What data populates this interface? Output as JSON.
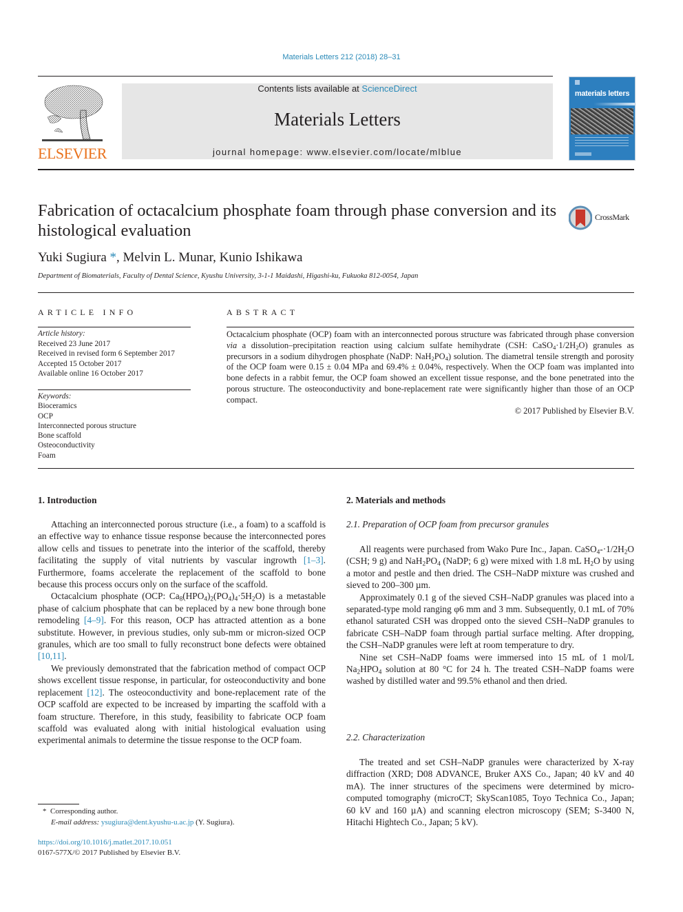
{
  "header": {
    "citation": "Materials Letters 212 (2018) 28–31",
    "contents_prefix": "Contents lists available at ",
    "contents_link": "ScienceDirect",
    "journal_name": "Materials Letters",
    "homepage_prefix": "journal homepage: ",
    "homepage_url": "www.elsevier.com/locate/mlblue",
    "publisher_logo_text": "ELSEVIER",
    "cover_title": "materials letters",
    "colors": {
      "link": "#2a8ab8",
      "publisher_orange": "#e9711c",
      "masthead_bg": "#e6e6e6",
      "cover_blue": "#2d7fbf"
    }
  },
  "article": {
    "title": "Fabrication of octacalcium phosphate foam through phase conversion and its histological evaluation",
    "crossmark_label": "CrossMark",
    "authors": [
      {
        "name": "Yuki Sugiura",
        "mark": "*"
      },
      {
        "name": "Melvin L. Munar",
        "mark": ""
      },
      {
        "name": "Kunio Ishikawa",
        "mark": ""
      }
    ],
    "affiliation": "Department of Biomaterials, Faculty of Dental Science, Kyushu University, 3-1-1 Maidashi, Higashi-ku, Fukuoka 812-0054, Japan"
  },
  "article_info": {
    "heading": "ARTICLE INFO",
    "history_label": "Article history:",
    "history": [
      "Received 23 June 2017",
      "Received in revised form 6 September 2017",
      "Accepted 15 October 2017",
      "Available online 16 October 2017"
    ],
    "keywords_label": "Keywords:",
    "keywords": [
      "Bioceramics",
      "OCP",
      "Interconnected porous structure",
      "Bone scaffold",
      "Osteoconductivity",
      "Foam"
    ]
  },
  "abstract": {
    "heading": "ABSTRACT",
    "p1": "Octacalcium phosphate (OCP) foam with an interconnected porous structure was fabricated through phase conversion ",
    "p1_via": "via",
    "p2": " a dissolution–precipitation reaction using calcium sulfate hemihydrate (CSH: CaSO",
    "p3": "·1/2H",
    "p4": "O) granules as precursors in a sodium dihydrogen phosphate (NaDP: NaH",
    "p5": "PO",
    "p6": ") solution. The diametral tensile strength and porosity of the OCP foam were 0.15 ± 0.04 MPa and 69.4% ± 0.04%, respectively. When the OCP foam was implanted into bone defects in a rabbit femur, the OCP foam showed an excellent tissue response, and the bone penetrated into the porous structure. The osteoconductivity and bone-replacement rate were significantly higher than those of an OCP compact.",
    "copyright": "© 2017 Published by Elsevier B.V."
  },
  "sections": {
    "intro": {
      "heading": "1. Introduction",
      "p1a": "Attaching an interconnected porous structure (i.e., a foam) to a scaffold is an effective way to enhance tissue response because the interconnected pores allow cells and tissues to penetrate into the interior of the scaffold, thereby facilitating the supply of vital nutrients by vascular ingrowth ",
      "p1_ref": "[1–3]",
      "p1b": ". Furthermore, foams accelerate the replacement of the scaffold to bone because this process occurs only on the surface of the scaffold.",
      "p2a": "Octacalcium phosphate (OCP: Ca",
      "p2_f1": "8",
      "p2_f2": "(HPO",
      "p2_f3": "4",
      "p2_f4": ")",
      "p2_f5": "2",
      "p2_f6": "(PO",
      "p2_f7": "4",
      "p2_f8": ")",
      "p2_f9": "4",
      "p2_f10": "·5H",
      "p2_f11": "2",
      "p2b": "O) is a metastable phase of calcium phosphate that can be replaced by a new bone through bone remodeling ",
      "p2_ref1": "[4–9]",
      "p2c": ". For this reason, OCP has attracted attention as a bone substitute. However, in previous studies, only sub-mm or micron-sized OCP granules, which are too small to fully reconstruct bone defects were obtained ",
      "p2_ref2": "[10,11]",
      "p2d": ".",
      "p3a": "We previously demonstrated that the fabrication method of compact OCP shows excellent tissue response, in particular, for osteoconductivity and bone replacement ",
      "p3_ref": "[12]",
      "p3b": ". The osteoconductivity and bone-replacement rate of the OCP scaffold are expected to be increased by imparting the scaffold with a foam structure. Therefore, in this study, feasibility to fabricate OCP foam scaffold was evaluated along with initial histological evaluation using experimental animals to determine the tissue response to the OCP foam."
    },
    "methods": {
      "heading": "2. Materials and methods",
      "sub1_heading": "2.1. Preparation of OCP foam from precursor granules",
      "s1p1a": "All reagents were purchased from Wako Pure Inc., Japan. CaSO",
      "s1p1b": "-·1/2H",
      "s1p1c": "O (CSH; 9 g) and NaH",
      "s1p1d": "PO",
      "s1p1e": " (NaDP; 6 g) were mixed with 1.8 mL H",
      "s1p1f": "O by using a motor and pestle and then dried. The CSH–NaDP mixture was crushed and sieved to 200–300 µm.",
      "s1p2": "Approximately 0.1 g of the sieved CSH–NaDP granules was placed into a separated-type mold ranging φ6 mm and 3 mm. Subsequently, 0.1 mL of 70% ethanol saturated CSH was dropped onto the sieved CSH–NaDP granules to fabricate CSH–NaDP foam through partial surface melting. After dropping, the CSH–NaDP granules were left at room temperature to dry.",
      "s1p3a": "Nine set CSH–NaDP foams were immersed into 15 mL of 1 mol/L Na",
      "s1p3b": "HPO",
      "s1p3c": " solution at 80 °C for 24 h. The treated CSH–NaDP foams were washed by distilled water and 99.5% ethanol and then dried.",
      "sub2_heading": "2.2. Characterization",
      "s2p1": "The treated and set CSH–NaDP granules were characterized by X-ray diffraction (XRD; D08 ADVANCE, Bruker AXS Co., Japan; 40 kV and 40 mA). The inner structures of the specimens were determined by micro-computed tomography (microCT; SkyScan1085, Toyo Technica Co., Japan; 60 kV and 160 µA) and scanning electron microscopy (SEM; S-3400 N, Hitachi Hightech Co., Japan; 5 kV)."
    }
  },
  "footnotes": {
    "star": "*",
    "corresponding": "Corresponding author.",
    "email_label": "E-mail address: ",
    "email": "ysugiura@dent.kyushu-u.ac.jp",
    "email_suffix": " (Y. Sugiura).",
    "doi": "https://doi.org/10.1016/j.matlet.2017.10.051",
    "issn_line": "0167-577X/© 2017 Published by Elsevier B.V."
  },
  "sub": {
    "two": "2",
    "four": "4"
  }
}
